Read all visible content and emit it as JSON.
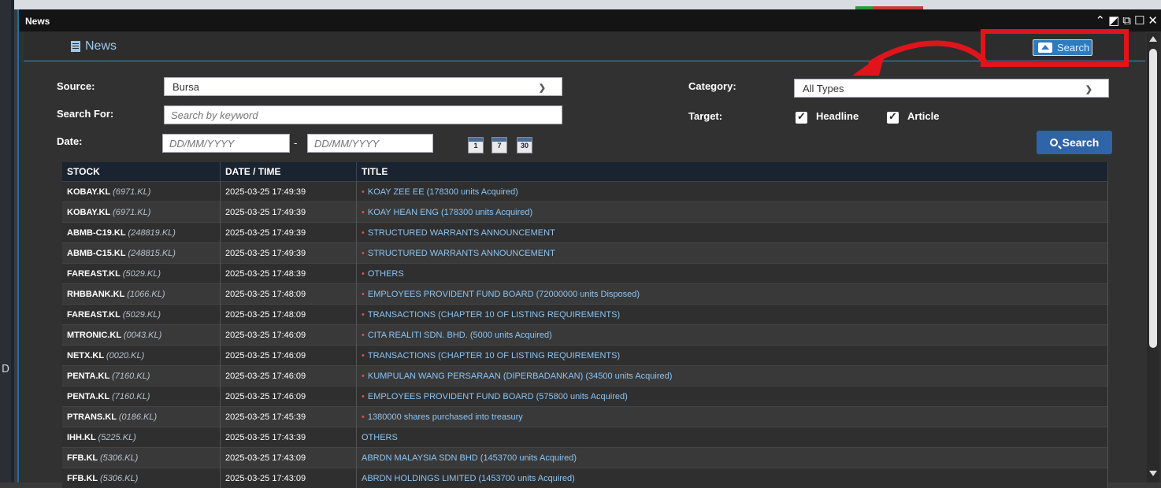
{
  "window": {
    "title": "News"
  },
  "panel": {
    "title": "News",
    "toggle_label": "Search"
  },
  "form": {
    "source_label": "Source:",
    "source_value": "Bursa",
    "search_for_label": "Search For:",
    "search_placeholder": "Search by keyword",
    "date_label": "Date:",
    "date_from_placeholder": "DD/MM/YYYY",
    "date_sep": "-",
    "date_to_placeholder": "DD/MM/YYYY",
    "quick_ranges": [
      "1",
      "7",
      "30"
    ],
    "category_label": "Category:",
    "category_value": "All Types",
    "target_label": "Target:",
    "headline_label": "Headline",
    "article_label": "Article",
    "search_button": "Search"
  },
  "table": {
    "headers": [
      "STOCK",
      "DATE / TIME",
      "TITLE"
    ],
    "rows": [
      {
        "stock": "KOBAY.KL",
        "code": "(6971.KL)",
        "datetime": "2025-03-25 17:49:39",
        "title": "KOAY ZEE EE (178300 units Acquired)",
        "new": true
      },
      {
        "stock": "KOBAY.KL",
        "code": "(6971.KL)",
        "datetime": "2025-03-25 17:49:39",
        "title": "KOAY HEAN ENG (178300 units Acquired)",
        "new": true
      },
      {
        "stock": "ABMB-C19.KL",
        "code": "(248819.KL)",
        "datetime": "2025-03-25 17:49:39",
        "title": "STRUCTURED WARRANTS ANNOUNCEMENT",
        "new": true
      },
      {
        "stock": "ABMB-C15.KL",
        "code": "(248815.KL)",
        "datetime": "2025-03-25 17:49:39",
        "title": "STRUCTURED WARRANTS ANNOUNCEMENT",
        "new": true
      },
      {
        "stock": "FAREAST.KL",
        "code": "(5029.KL)",
        "datetime": "2025-03-25 17:48:39",
        "title": "OTHERS",
        "new": true
      },
      {
        "stock": "RHBBANK.KL",
        "code": "(1066.KL)",
        "datetime": "2025-03-25 17:48:09",
        "title": "EMPLOYEES PROVIDENT FUND BOARD (72000000 units Disposed)",
        "new": true
      },
      {
        "stock": "FAREAST.KL",
        "code": "(5029.KL)",
        "datetime": "2025-03-25 17:48:09",
        "title": "TRANSACTIONS (CHAPTER 10 OF LISTING REQUIREMENTS)",
        "new": true
      },
      {
        "stock": "MTRONIC.KL",
        "code": "(0043.KL)",
        "datetime": "2025-03-25 17:46:09",
        "title": "CITA REALITI SDN. BHD. (5000 units Acquired)",
        "new": true
      },
      {
        "stock": "NETX.KL",
        "code": "(0020.KL)",
        "datetime": "2025-03-25 17:46:09",
        "title": "TRANSACTIONS (CHAPTER 10 OF LISTING REQUIREMENTS)",
        "new": true
      },
      {
        "stock": "PENTA.KL",
        "code": "(7160.KL)",
        "datetime": "2025-03-25 17:46:09",
        "title": "KUMPULAN WANG PERSARAAN (DIPERBADANKAN) (34500 units Acquired)",
        "new": true
      },
      {
        "stock": "PENTA.KL",
        "code": "(7160.KL)",
        "datetime": "2025-03-25 17:46:09",
        "title": "EMPLOYEES PROVIDENT FUND BOARD (575800 units Acquired)",
        "new": true
      },
      {
        "stock": "PTRANS.KL",
        "code": "(0186.KL)",
        "datetime": "2025-03-25 17:45:39",
        "title": "1380000 shares purchased into treasury",
        "new": true
      },
      {
        "stock": "IHH.KL",
        "code": "(5225.KL)",
        "datetime": "2025-03-25 17:43:39",
        "title": "OTHERS",
        "new": false
      },
      {
        "stock": "FFB.KL",
        "code": "(5306.KL)",
        "datetime": "2025-03-25 17:43:09",
        "title": "ABRDN MALAYSIA SDN BHD (1453700 units Acquired)",
        "new": false
      },
      {
        "stock": "FFB.KL",
        "code": "(5306.KL)",
        "datetime": "2025-03-25 17:43:09",
        "title": "ABRDN HOLDINGS LIMITED (1453700 units Acquired)",
        "new": false
      }
    ]
  },
  "background": {
    "left_letter": "D"
  },
  "colors": {
    "accent": "#2f64a6",
    "link": "#8cc4f2",
    "highlight_box": "#e1141c",
    "new_dot": "#e0504f"
  }
}
